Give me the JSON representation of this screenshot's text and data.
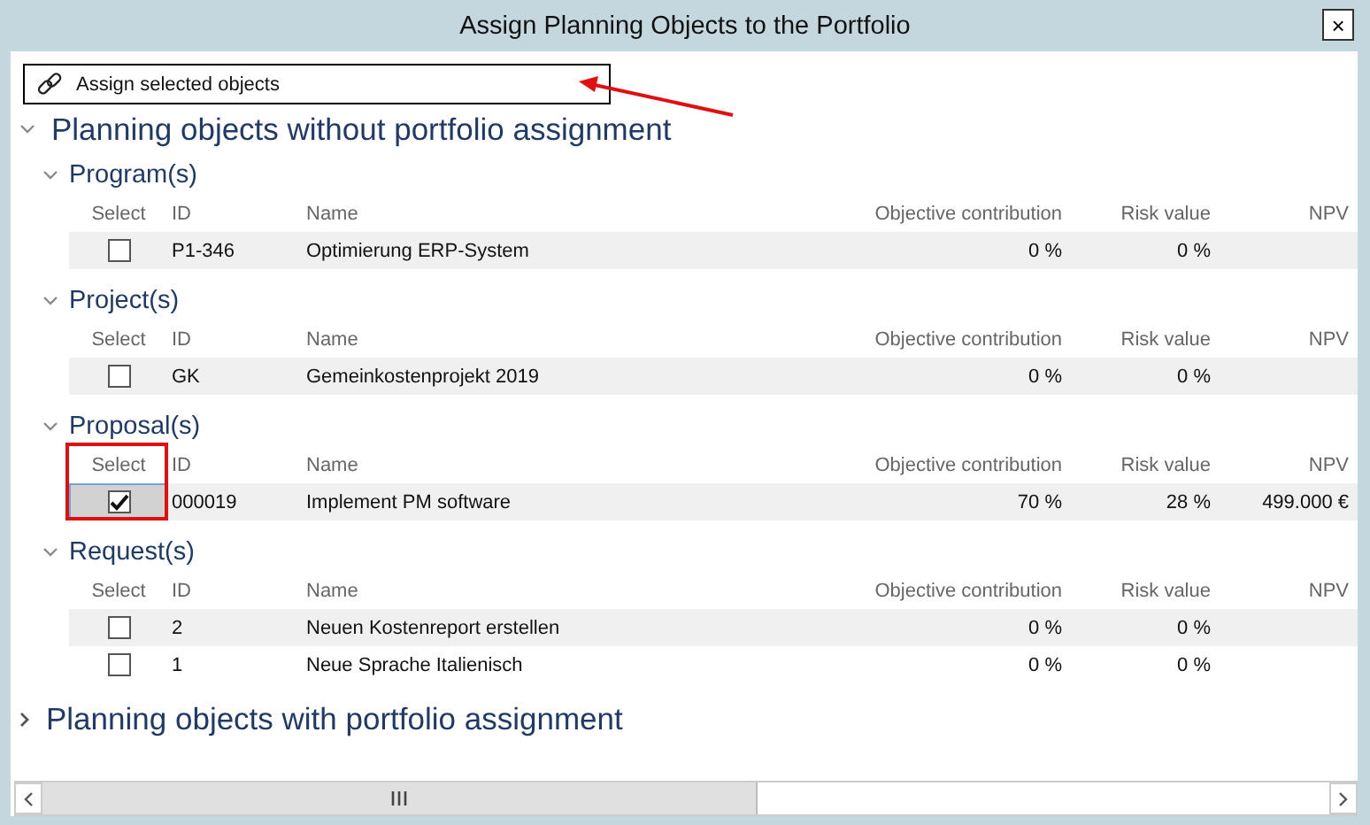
{
  "window": {
    "title": "Assign Planning Objects to the Portfolio",
    "close_label": "×"
  },
  "toolbar": {
    "label": "Assign selected objects",
    "annotated": true
  },
  "sections": [
    {
      "title": "Planning objects without portfolio assignment",
      "expanded": true,
      "groups": [
        {
          "title": "Program(s)",
          "expanded": true,
          "annotated": false,
          "columns": [
            "Select",
            "ID",
            "Name",
            "Objective contribution",
            "Risk value",
            "NPV"
          ],
          "rows": [
            {
              "checked": false,
              "focused": false,
              "id": "P1-346",
              "name": "Optimierung ERP-System",
              "objective": "0 %",
              "risk": "0 %"
            }
          ]
        },
        {
          "title": "Project(s)",
          "expanded": true,
          "annotated": false,
          "columns": [
            "Select",
            "ID",
            "Name",
            "Objective contribution",
            "Risk value",
            "NPV"
          ],
          "rows": [
            {
              "checked": false,
              "focused": false,
              "id": "GK",
              "name": "Gemeinkostenprojekt 2019",
              "objective": "0 %",
              "risk": "0 %"
            }
          ]
        },
        {
          "title": "Proposal(s)",
          "expanded": true,
          "annotated": true,
          "columns": [
            "Select",
            "ID",
            "Name",
            "Objective contribution",
            "Risk value",
            "NPV"
          ],
          "rows": [
            {
              "checked": true,
              "focused": true,
              "id": "000019",
              "name": "Implement PM software",
              "objective": "70 %",
              "risk": "28 %",
              "npv": "499.000 €"
            }
          ]
        },
        {
          "title": "Request(s)",
          "expanded": true,
          "annotated": false,
          "columns": [
            "Select",
            "ID",
            "Name",
            "Objective contribution",
            "Risk value",
            "NPV"
          ],
          "rows": [
            {
              "checked": false,
              "focused": false,
              "id": "2",
              "name": "Neuen Kostenreport erstellen",
              "objective": "0 %",
              "risk": "0 %"
            },
            {
              "checked": false,
              "focused": false,
              "id": "1",
              "name": "Neue Sprache Italienisch",
              "objective": "0 %",
              "risk": "0 %"
            }
          ]
        }
      ]
    },
    {
      "title": "Planning objects with portfolio assignment",
      "expanded": false
    }
  ]
}
